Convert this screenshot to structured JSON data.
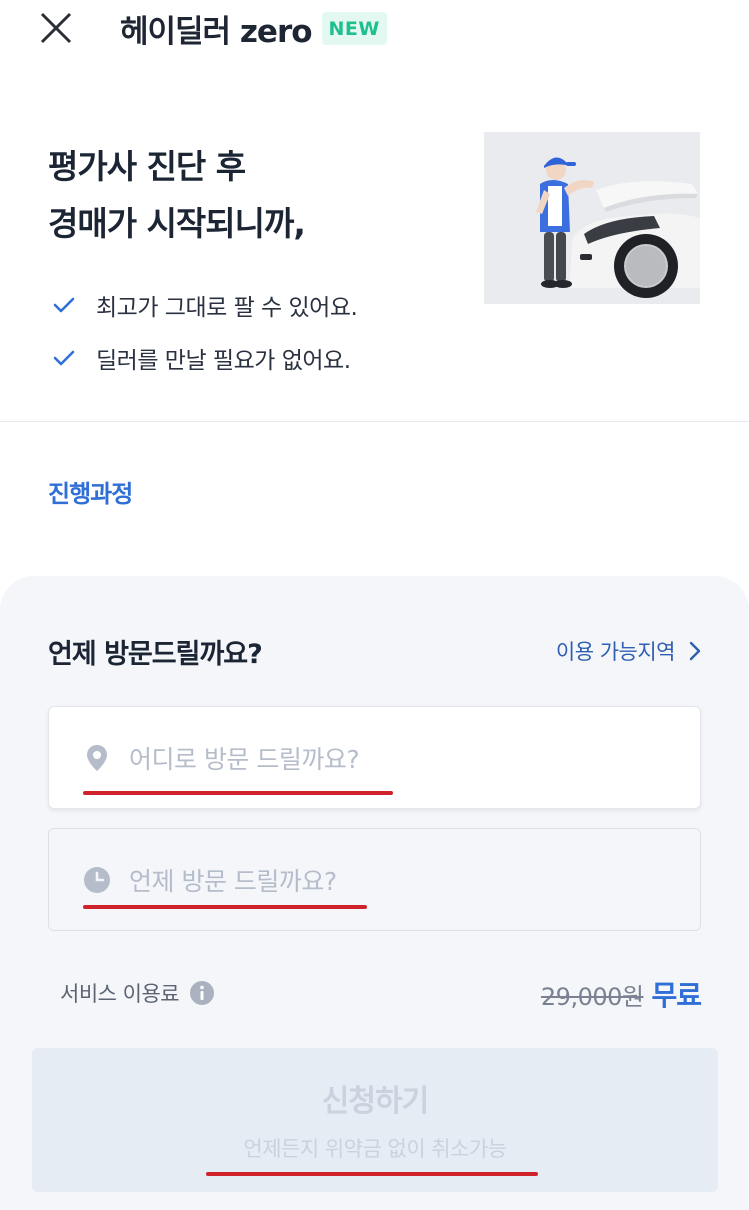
{
  "header": {
    "brand_name": "헤이딜러 zero",
    "badge": "NEW",
    "close_icon": "close-icon"
  },
  "hero": {
    "title_line1": "평가사 진단 후",
    "title_line2": "경매가 시작되니까,",
    "checks": [
      "최고가 그대로 팔 수 있어요.",
      "딜러를 만날 필요가 없어요."
    ],
    "illustration": "mechanic-inspecting-car-illustration"
  },
  "process_link": "진행과정",
  "panel": {
    "title": "언제 방문드릴까요?",
    "area_link": "이용 가능지역",
    "location_field": {
      "placeholder": "어디로 방문 드릴까요?",
      "icon": "location-pin-icon"
    },
    "time_field": {
      "placeholder": "언제 방문 드릴까요?",
      "icon": "clock-icon"
    },
    "fee": {
      "label": "서비스 이용료",
      "original_price": "29,000원",
      "price": "무료"
    },
    "submit": {
      "label": "신청하기",
      "sub_label": "언제든지 위약금 없이 취소가능"
    }
  },
  "colors": {
    "accent": "#2f6fd6",
    "badge_text": "#1fbf8f",
    "badge_bg": "#e3f8f0",
    "panel_bg": "#f4f6fa",
    "annotation_red": "#d0222a",
    "disabled_button": "#e6ecf4"
  }
}
